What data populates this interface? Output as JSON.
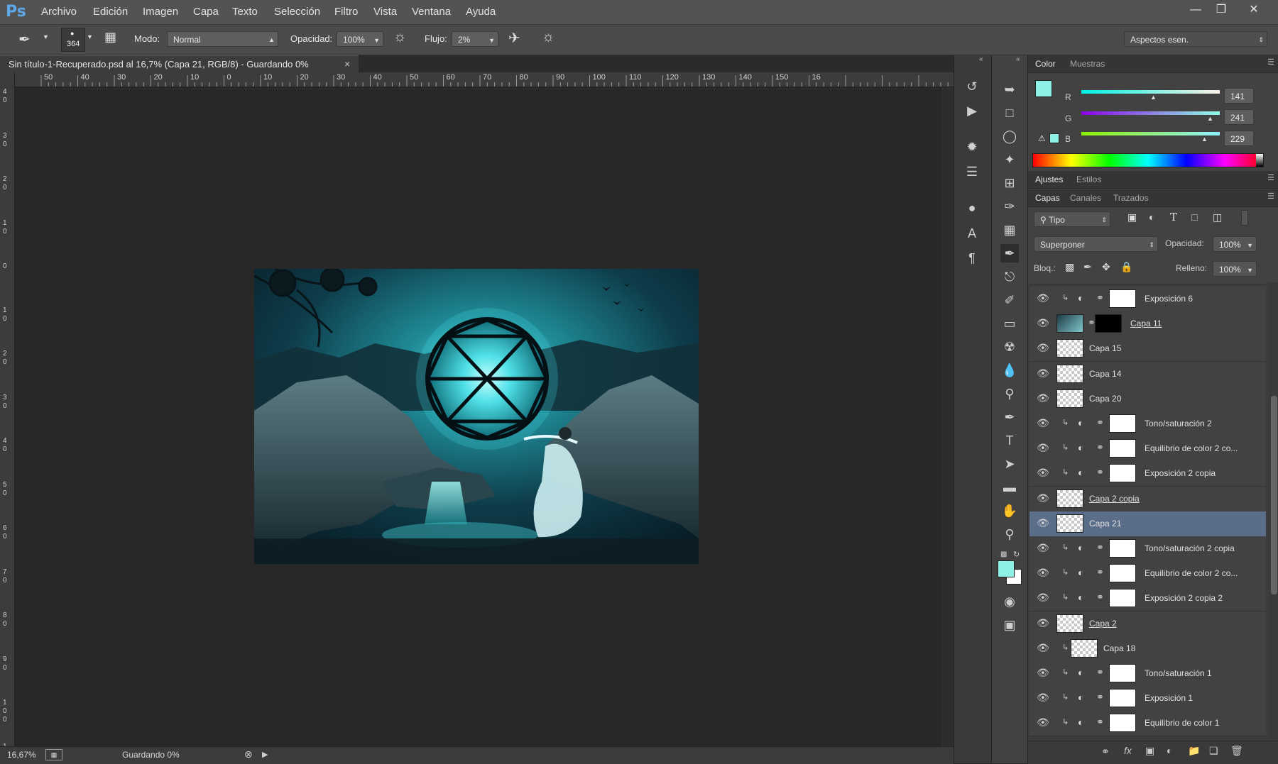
{
  "app": {
    "logo": "Ps"
  },
  "menu": [
    "Archivo",
    "Edición",
    "Imagen",
    "Capa",
    "Texto",
    "Selección",
    "Filtro",
    "Vista",
    "Ventana",
    "Ayuda"
  ],
  "options": {
    "brush_size": "364",
    "mode_label": "Modo:",
    "mode_value": "Normal",
    "opacity_label": "Opacidad:",
    "opacity_value": "100%",
    "flow_label": "Flujo:",
    "flow_value": "2%",
    "workspace": "Aspectos esen."
  },
  "document": {
    "tab_title": "Sin título-1-Recuperado.psd al 16,7% (Capa 21, RGB/8) - Guardando 0%",
    "close": "×"
  },
  "ruler": {
    "h_ticks": [
      "50",
      "40",
      "30",
      "20",
      "10",
      "0",
      "10",
      "20",
      "30",
      "40",
      "50",
      "60",
      "70",
      "80",
      "90",
      "100",
      "110",
      "120",
      "130",
      "140",
      "150",
      "16"
    ],
    "v_ticks": [
      "4\n0",
      "3\n0",
      "2\n0",
      "1\n0",
      "0",
      "1\n0",
      "2\n0",
      "3\n0",
      "4\n0",
      "5\n0",
      "6\n0",
      "7\n0",
      "8\n0",
      "9\n0",
      "1\n0\n0",
      "1"
    ]
  },
  "status": {
    "zoom": "16,67%",
    "message": "Guardando 0%"
  },
  "color_panel": {
    "tabs": [
      "Color",
      "Muestras"
    ],
    "r_label": "R",
    "r": "141",
    "g_label": "G",
    "g": "241",
    "b_label": "B",
    "b": "229",
    "fg_color": "#8df1e5"
  },
  "adjust_panel": {
    "tabs": [
      "Ajustes",
      "Estilos"
    ]
  },
  "layers_panel": {
    "tabs": [
      "Capas",
      "Canales",
      "Trazados"
    ],
    "filter": "Tipo",
    "blend_mode": "Superponer",
    "opacity_label": "Opacidad:",
    "opacity": "100%",
    "lock_label": "Bloq.:",
    "fill_label": "Relleno:",
    "fill": "100%",
    "layers": [
      {
        "name": "Exposición 6"
      },
      {
        "name": "Capa 11"
      },
      {
        "name": "Capa 15"
      },
      {
        "name": "Capa 14"
      },
      {
        "name": "Capa 20"
      },
      {
        "name": "Tono/saturación 2"
      },
      {
        "name": "Equilibrio de color 2 co..."
      },
      {
        "name": "Exposición 2 copia"
      },
      {
        "name": "Capa 2 copia"
      },
      {
        "name": "Capa 21"
      },
      {
        "name": "Tono/saturación 2 copia"
      },
      {
        "name": "Equilibrio de color 2 co..."
      },
      {
        "name": "Exposición 2 copia 2"
      },
      {
        "name": "Capa 2"
      },
      {
        "name": "Capa 18"
      },
      {
        "name": "Tono/saturación 1"
      },
      {
        "name": "Exposición 1"
      },
      {
        "name": "Equilibrio de color 1"
      }
    ]
  },
  "colors": {
    "accent": "#5a6e8a",
    "fg_swatch": "#8df1e5",
    "bg_swatch": "#ffffff"
  }
}
